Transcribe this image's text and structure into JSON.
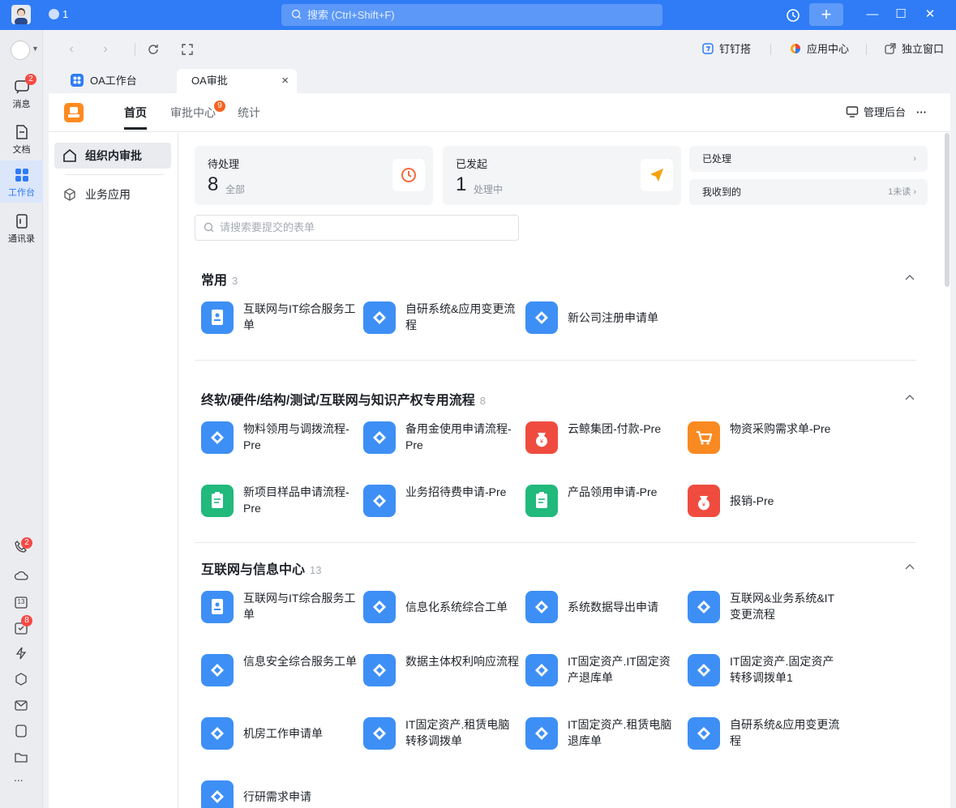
{
  "titlebar": {
    "status_count": "1",
    "search_placeholder": "搜索 (Ctrl+Shift+F)",
    "accent": "#2f7cf6"
  },
  "leftnav": {
    "items": [
      {
        "label": "消息",
        "badge": "2"
      },
      {
        "label": "文档"
      },
      {
        "label": "工作台"
      },
      {
        "label": "通讯录"
      }
    ],
    "call_badge": "2",
    "todo_badge": "8",
    "calendar_day": "13",
    "more": "..."
  },
  "toolbar": {
    "dingding": "钉钉搭",
    "app_center": "应用中心",
    "standalone": "独立窗口"
  },
  "tabs": [
    {
      "label": "OA工作台"
    },
    {
      "label": "OA审批"
    }
  ],
  "app_header": {
    "tabs": [
      {
        "label": "首页"
      },
      {
        "label": "审批中心",
        "badge": "9"
      },
      {
        "label": "统计"
      }
    ],
    "admin": "管理后台",
    "more": "···"
  },
  "sidebar": {
    "items": [
      {
        "label": "组织内审批"
      },
      {
        "label": "业务应用"
      }
    ]
  },
  "cards": {
    "pending": {
      "title": "待处理",
      "count": "8",
      "sub": "全部"
    },
    "initiated": {
      "title": "已发起",
      "count": "1",
      "sub": "处理中"
    },
    "processed": {
      "title": "已处理"
    },
    "received": {
      "title": "我收到的",
      "sub": "1未读"
    }
  },
  "form_search_placeholder": "请搜索要提交的表单",
  "sections": [
    {
      "title": "常用",
      "count": "3",
      "apps": [
        {
          "label": "互联网与IT综合服务工单"
        },
        {
          "label": "自研系统&应用变更流程"
        },
        {
          "label": "新公司注册申请单"
        }
      ]
    },
    {
      "title": "终软/硬件/结构/测试/互联网与知识产权专用流程",
      "count": "8",
      "apps": [
        {
          "label": "物料领用与调拨流程-Pre"
        },
        {
          "label": "备用金使用申请流程-Pre"
        },
        {
          "label": "云鲸集团-付款-Pre"
        },
        {
          "label": "物资采购需求单-Pre"
        },
        {
          "label": "新项目样品申请流程-Pre"
        },
        {
          "label": "业务招待费申请-Pre"
        },
        {
          "label": "产品领用申请-Pre"
        },
        {
          "label": "报销-Pre"
        }
      ]
    },
    {
      "title": "互联网与信息中心",
      "count": "13",
      "apps": [
        {
          "label": "互联网与IT综合服务工单"
        },
        {
          "label": "信息化系统综合工单"
        },
        {
          "label": "系统数据导出申请"
        },
        {
          "label": "互联网&业务系统&IT变更流程"
        },
        {
          "label": "信息安全综合服务工单"
        },
        {
          "label": "数据主体权利响应流程"
        },
        {
          "label": "IT固定资产.IT固定资产退库单"
        },
        {
          "label": "IT固定资产.固定资产转移调拨单1"
        },
        {
          "label": "机房工作申请单"
        },
        {
          "label": "IT固定资产.租赁电脑转移调拨单"
        },
        {
          "label": "IT固定资产.租赁电脑退库单"
        },
        {
          "label": "自研系统&应用变更流程"
        },
        {
          "label": "行研需求申请"
        }
      ]
    }
  ]
}
